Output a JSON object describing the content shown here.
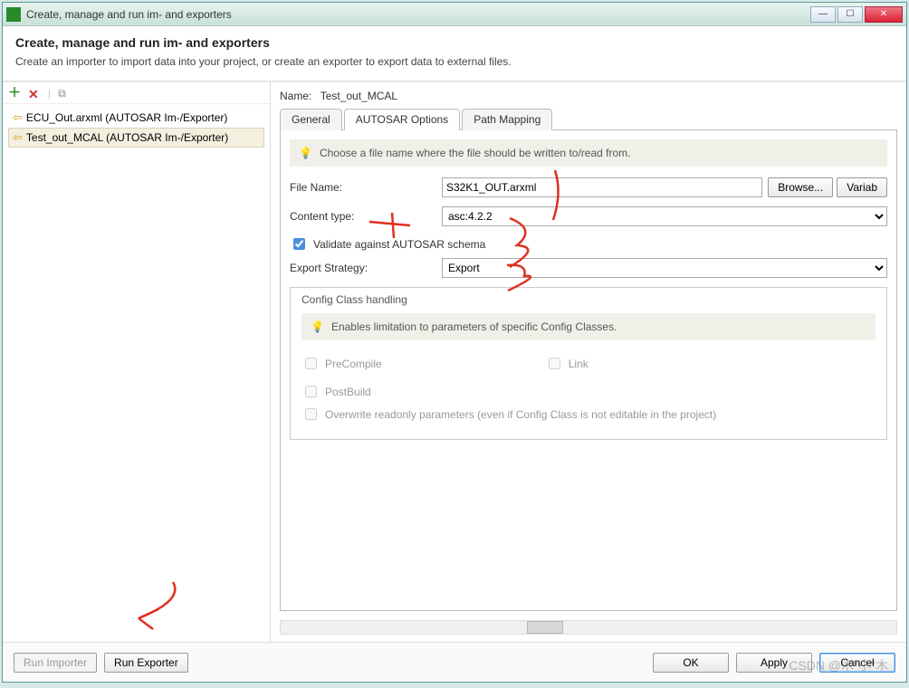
{
  "window": {
    "title": "Create, manage and run im- and exporters"
  },
  "header": {
    "title": "Create, manage and run im- and exporters",
    "subtitle": "Create an importer to import data into your project, or create an exporter to export data to external files."
  },
  "sidebar": {
    "items": [
      {
        "label": "ECU_Out.arxml (AUTOSAR Im-/Exporter)",
        "selected": false
      },
      {
        "label": "Test_out_MCAL (AUTOSAR Im-/Exporter)",
        "selected": true
      }
    ]
  },
  "main": {
    "name_label": "Name:",
    "name_value": "Test_out_MCAL",
    "tabs": [
      {
        "label": "General"
      },
      {
        "label": "AUTOSAR Options"
      },
      {
        "label": "Path Mapping"
      }
    ],
    "active_tab": 1,
    "tip": "Choose a file name where the file should be written to/read from.",
    "filename_label": "File Name:",
    "filename_value": "S32K1_OUT.arxml",
    "browse_label": "Browse...",
    "variab_label": "Variab",
    "contenttype_label": "Content type:",
    "contenttype_value": "asc:4.2.2",
    "validate_label": "Validate against AUTOSAR schema",
    "validate_checked": true,
    "exportstrategy_label": "Export Strategy:",
    "exportstrategy_value": "Export",
    "group": {
      "title": "Config Class handling",
      "tip": "Enables limitation to parameters of specific Config Classes.",
      "precompile": "PreCompile",
      "link": "Link",
      "postbuild": "PostBuild",
      "overwrite": "Overwrite readonly parameters (even if Config Class is not editable in the project)"
    }
  },
  "footer": {
    "run_importer": "Run Importer",
    "run_exporter": "Run Exporter",
    "ok": "OK",
    "apply": "Apply",
    "cancel": "Cancel"
  },
  "watermark": "CSDN @木\"小\"木"
}
